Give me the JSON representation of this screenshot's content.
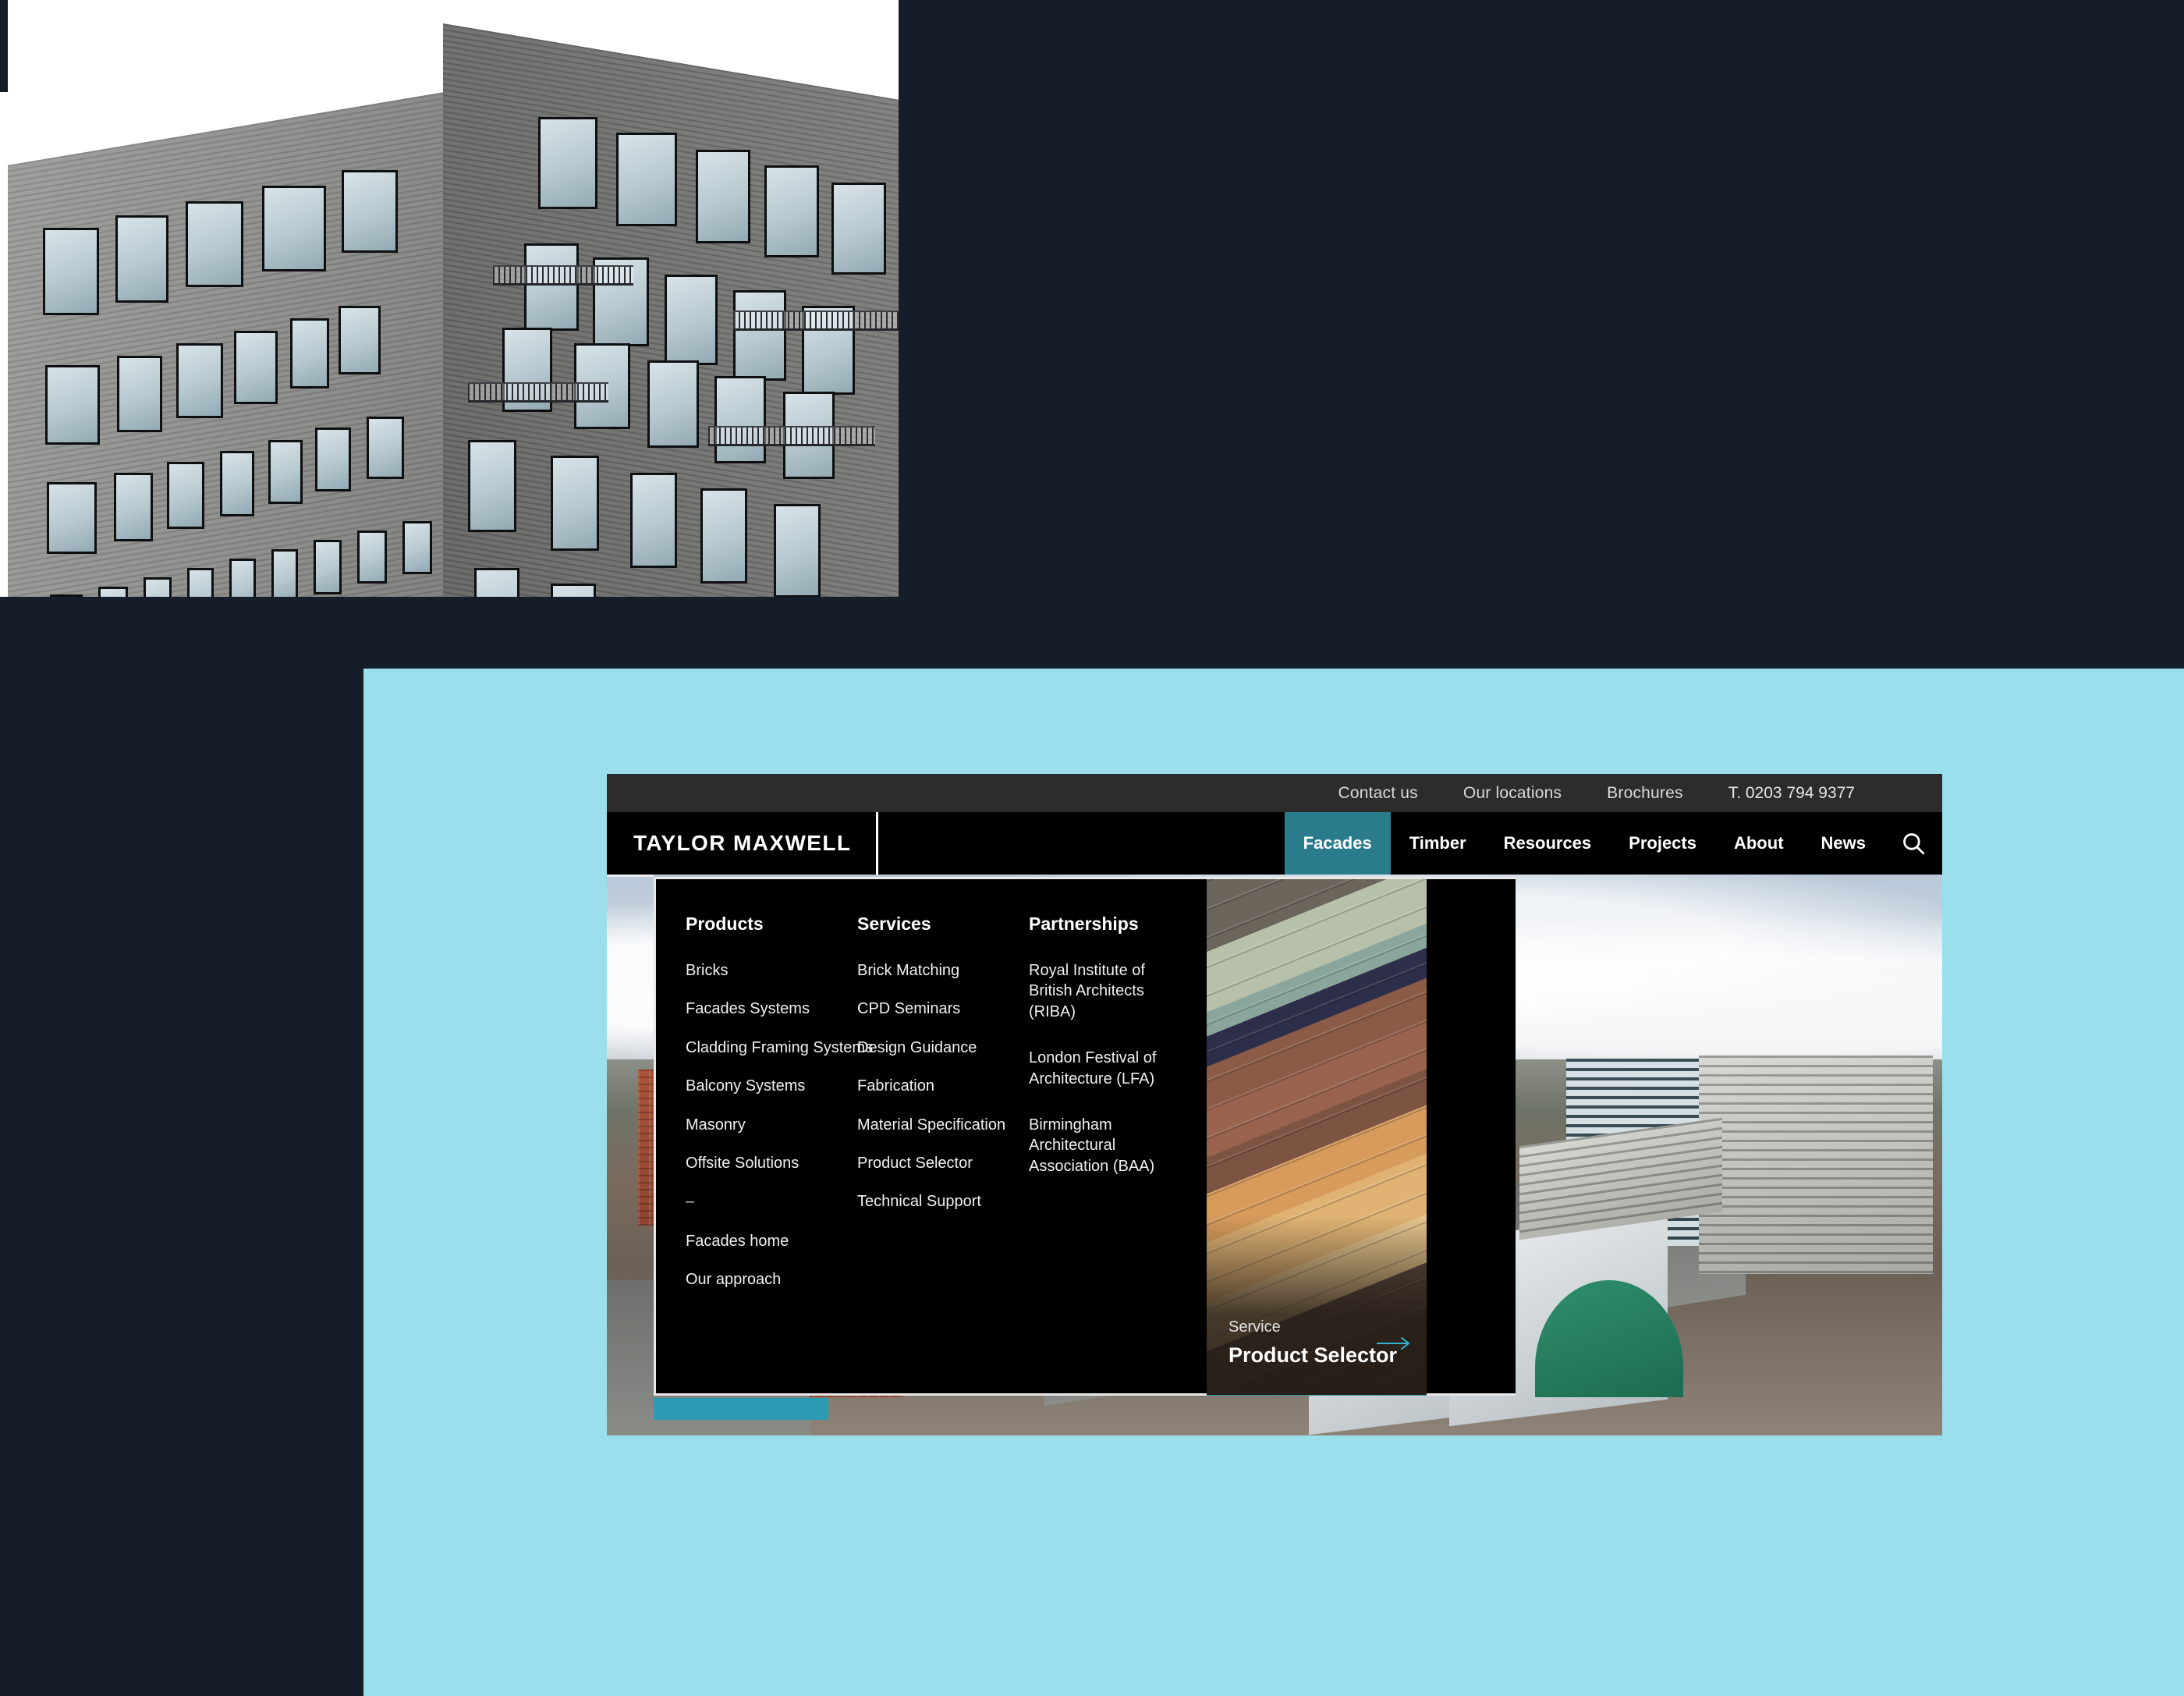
{
  "colors": {
    "page_background": "#161d2a",
    "panel_blue": "#9bdeec",
    "accent_teal": "#2a7c8c",
    "accent_teal_bright": "#2a9bb3",
    "nav_black": "#000000",
    "util_bar_grey": "#2c2c2c"
  },
  "brand": {
    "logo": "TAYLOR MAXWELL"
  },
  "utility_bar": {
    "links": [
      {
        "label": "Contact us"
      },
      {
        "label": "Our locations"
      },
      {
        "label": "Brochures"
      }
    ],
    "phone": "T. 0203 794 9377"
  },
  "nav": {
    "items": [
      {
        "label": "Facades",
        "active": true
      },
      {
        "label": "Timber",
        "active": false
      },
      {
        "label": "Resources",
        "active": false
      },
      {
        "label": "Projects",
        "active": false
      },
      {
        "label": "About",
        "active": false
      },
      {
        "label": "News",
        "active": false
      }
    ],
    "search_icon": "search-icon"
  },
  "mega_menu": {
    "columns": [
      {
        "title": "Products",
        "links": [
          "Bricks",
          "Facades Systems",
          "Cladding Framing Systems",
          "Balcony Systems",
          "Masonry",
          "Offsite Solutions",
          "–",
          "Facades home",
          "Our approach"
        ]
      },
      {
        "title": "Services",
        "links": [
          "Brick Matching",
          "CPD Seminars",
          "Design Guidance",
          "Fabrication",
          "Material Specification",
          "Product Selector",
          "Technical Support"
        ]
      },
      {
        "title": "Partnerships",
        "links": [
          "Royal Institute of British Architects (RIBA)",
          "London Festival of Architecture (LFA)",
          "Birmingham Architectural Association (BAA)"
        ]
      }
    ],
    "promo": {
      "kicker": "Service",
      "title": "Product Selector",
      "arrow_icon": "arrow-right-icon",
      "image": "brick-samples-photo"
    }
  },
  "hero": {
    "top_image": "grey-brick-building-photo",
    "site_background_image": "aerial-cityscape-photo"
  }
}
